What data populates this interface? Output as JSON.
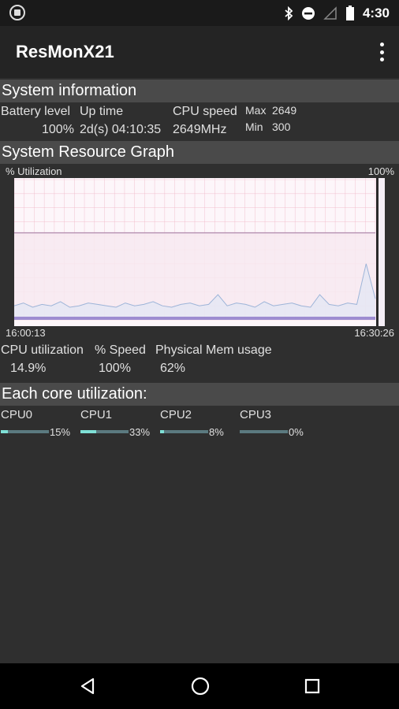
{
  "status_bar": {
    "time": "4:30",
    "icons": [
      "app-notification-icon",
      "bluetooth-icon",
      "do-not-disturb-icon",
      "signal-icon",
      "battery-icon"
    ]
  },
  "app_bar": {
    "title": "ResMonX21",
    "overflow_icon": "more-vert-icon"
  },
  "system_information": {
    "header": "System information",
    "battery_label": "Battery level",
    "battery_value": "100%",
    "uptime_label": "Up time",
    "uptime_value": "2d(s) 04:10:35",
    "cpu_speed_label": "CPU speed",
    "cpu_speed_value": "2649MHz",
    "max_label": "Max",
    "max_value": "2649",
    "min_label": "Min",
    "min_value": "300"
  },
  "resource_graph": {
    "header": "System Resource Graph",
    "y_label": "% Utilization",
    "y_max_label": "100%",
    "x_start": "16:00:13",
    "x_end": "16:30:26",
    "colors": {
      "memory_fill": "#f7e9f0",
      "memory_line": "#b48fb0",
      "cpu_line": "#9db4d8",
      "grid": "#f0b8c8",
      "cursor": "#2a2a2a",
      "bottom_band": "#8a76c8"
    }
  },
  "chart_data": {
    "type": "line",
    "title": "System Resource Graph",
    "ylabel": "% Utilization",
    "ylim": [
      0,
      100
    ],
    "x_range": [
      "16:00:13",
      "16:30:26"
    ],
    "series": [
      {
        "values": [
          62,
          62,
          62,
          62,
          62,
          62,
          62,
          62,
          62,
          62,
          62,
          62,
          62,
          62,
          62,
          62,
          62,
          62,
          62,
          62,
          62,
          62,
          62,
          62,
          62,
          62,
          62,
          62,
          62,
          62,
          62,
          62,
          62,
          62,
          62,
          62,
          62,
          62,
          62,
          62
        ]
      },
      {
        "values": [
          10,
          12,
          9,
          11,
          10,
          13,
          9,
          10,
          12,
          11,
          10,
          9,
          12,
          10,
          11,
          13,
          10,
          9,
          11,
          12,
          10,
          11,
          18,
          10,
          12,
          11,
          9,
          13,
          10,
          11,
          12,
          10,
          9,
          18,
          11,
          10,
          12,
          11,
          40,
          15
        ]
      }
    ]
  },
  "stats": {
    "cpu_util_label": "CPU utilization",
    "cpu_util_value": "14.9%",
    "speed_label": "% Speed",
    "speed_value": "100%",
    "mem_label": "Physical Mem usage",
    "mem_value": "62%"
  },
  "cores": {
    "header": "Each core utilization:",
    "items": [
      {
        "label": "CPU0",
        "pct_text": "15%",
        "fraction": 0.15
      },
      {
        "label": "CPU1",
        "pct_text": "33%",
        "fraction": 0.33
      },
      {
        "label": "CPU2",
        "pct_text": "8%",
        "fraction": 0.08
      },
      {
        "label": "CPU3",
        "pct_text": "0%",
        "fraction": 0.0
      }
    ]
  },
  "nav_bar": {
    "back_icon": "back-triangle-icon",
    "home_icon": "home-circle-icon",
    "recents_icon": "recents-square-icon"
  }
}
